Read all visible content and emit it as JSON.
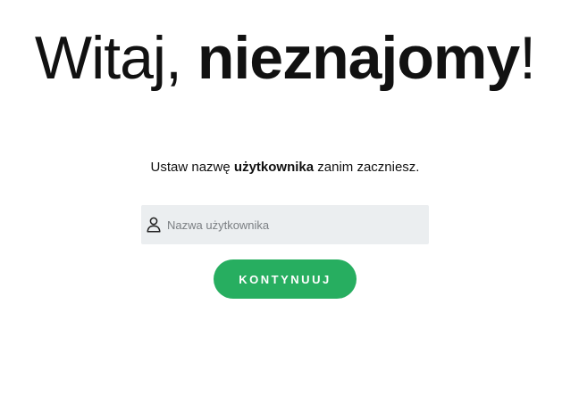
{
  "heading": {
    "prefix": "Witaj, ",
    "name": "nieznajomy",
    "suffix": "!"
  },
  "instruction": {
    "before": "Ustaw nazwę ",
    "emphasis": "użytkownika",
    "after": " zanim zaczniesz."
  },
  "username_field": {
    "icon": "user-icon",
    "placeholder": "Nazwa użytkownika",
    "value": ""
  },
  "continue_button": {
    "label": "KONTYNUUJ"
  },
  "colors": {
    "accent": "#27ae60",
    "field_background": "#ebeef0",
    "text": "#111111"
  }
}
